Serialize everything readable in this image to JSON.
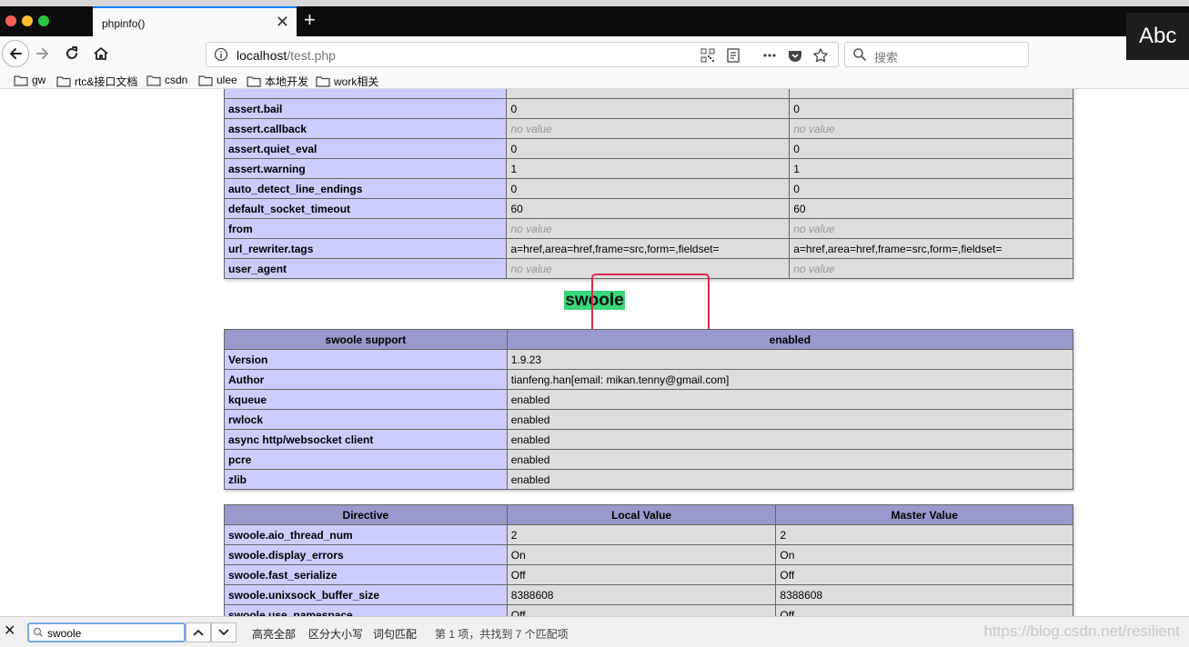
{
  "browser": {
    "tab_title": "phpinfo()",
    "tab_close": "✕",
    "new_tab": "+",
    "input_method": "Abc",
    "url_host": "localhost",
    "url_path": "/test.php",
    "search_placeholder": "搜索",
    "bookmarks": [
      "gw",
      "rtc&接口文档",
      "csdn",
      "ulee",
      "本地开发",
      "work相关"
    ]
  },
  "directives_table": {
    "rows": [
      {
        "name": "assert.bail",
        "local": "0",
        "master": "0"
      },
      {
        "name": "assert.callback",
        "local": "no value",
        "master": "no value"
      },
      {
        "name": "assert.quiet_eval",
        "local": "0",
        "master": "0"
      },
      {
        "name": "assert.warning",
        "local": "1",
        "master": "1"
      },
      {
        "name": "auto_detect_line_endings",
        "local": "0",
        "master": "0"
      },
      {
        "name": "default_socket_timeout",
        "local": "60",
        "master": "60"
      },
      {
        "name": "from",
        "local": "no value",
        "master": "no value"
      },
      {
        "name": "url_rewriter.tags",
        "local": "a=href,area=href,frame=src,form=,fieldset=",
        "master": "a=href,area=href,frame=src,form=,fieldset="
      },
      {
        "name": "user_agent",
        "local": "no value",
        "master": "no value"
      }
    ]
  },
  "swoole": {
    "title": "swoole",
    "support_header": [
      "swoole support",
      "enabled"
    ],
    "info_rows": [
      {
        "name": "Version",
        "value": "1.9.23"
      },
      {
        "name": "Author",
        "value": "tianfeng.han[email: mikan.tenny@gmail.com]"
      },
      {
        "name": "kqueue",
        "value": "enabled"
      },
      {
        "name": "rwlock",
        "value": "enabled"
      },
      {
        "name": "async http/websocket client",
        "value": "enabled"
      },
      {
        "name": "pcre",
        "value": "enabled"
      },
      {
        "name": "zlib",
        "value": "enabled"
      }
    ],
    "directive_header": [
      "Directive",
      "Local Value",
      "Master Value"
    ],
    "directive_rows": [
      {
        "name": "swoole.aio_thread_num",
        "local": "2",
        "master": "2"
      },
      {
        "name": "swoole.display_errors",
        "local": "On",
        "master": "On"
      },
      {
        "name": "swoole.fast_serialize",
        "local": "Off",
        "master": "Off"
      },
      {
        "name": "swoole.unixsock_buffer_size",
        "local": "8388608",
        "master": "8388608"
      },
      {
        "name": "swoole.use_namespace",
        "local": "Off",
        "master": "Off"
      }
    ]
  },
  "findbar": {
    "query": "swoole",
    "highlight_all": "高亮全部",
    "match_case": "区分大小写",
    "whole_words": "词句匹配",
    "status": "第 1 项，共找到 7 个匹配项",
    "watermark": "https://blog.csdn.net/resilient"
  },
  "colors": {
    "php_header": "#9999cc",
    "php_key": "#ccccff",
    "php_value": "#dddddd",
    "find_highlight": "#38d878",
    "annotation_box": "#e2264d"
  }
}
